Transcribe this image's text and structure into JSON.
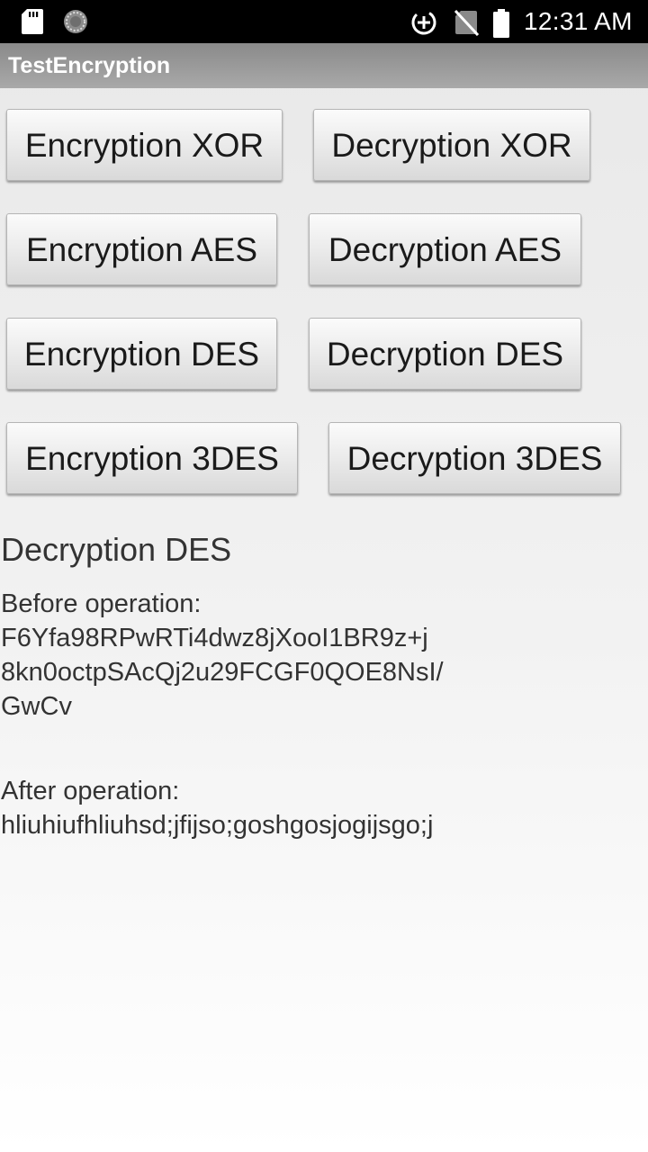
{
  "status_bar": {
    "time": "12:31 AM",
    "icons": [
      "sd-card-icon",
      "sync-icon",
      "data-saver-icon",
      "no-sim-icon",
      "battery-icon"
    ]
  },
  "action_bar": {
    "title": "TestEncryption"
  },
  "buttons": {
    "enc_xor": "Encryption XOR",
    "dec_xor": "Decryption XOR",
    "enc_aes": "Encryption AES",
    "dec_aes": "Decryption AES",
    "enc_des": "Encryption DES",
    "dec_des": "Decryption DES",
    "enc_3des": "Encryption 3DES",
    "dec_3des": "Decryption 3DES"
  },
  "result": {
    "operation": "Decryption DES",
    "before_label": "Before operation:",
    "before_lines": [
      "F6Yfa98RPwRTi4dwz8jXooI1BR9z+j",
      "8kn0octpSAcQj2u29FCGF0QOE8NsI/",
      "GwCv"
    ],
    "after_label": "After operation:",
    "after_value": "hliuhiufhliuhsd;jfijso;goshgosjogijsgo;j"
  },
  "colors": {
    "status_bar": "#000000",
    "action_bar": "#9a9a9a",
    "text": "#333333"
  }
}
